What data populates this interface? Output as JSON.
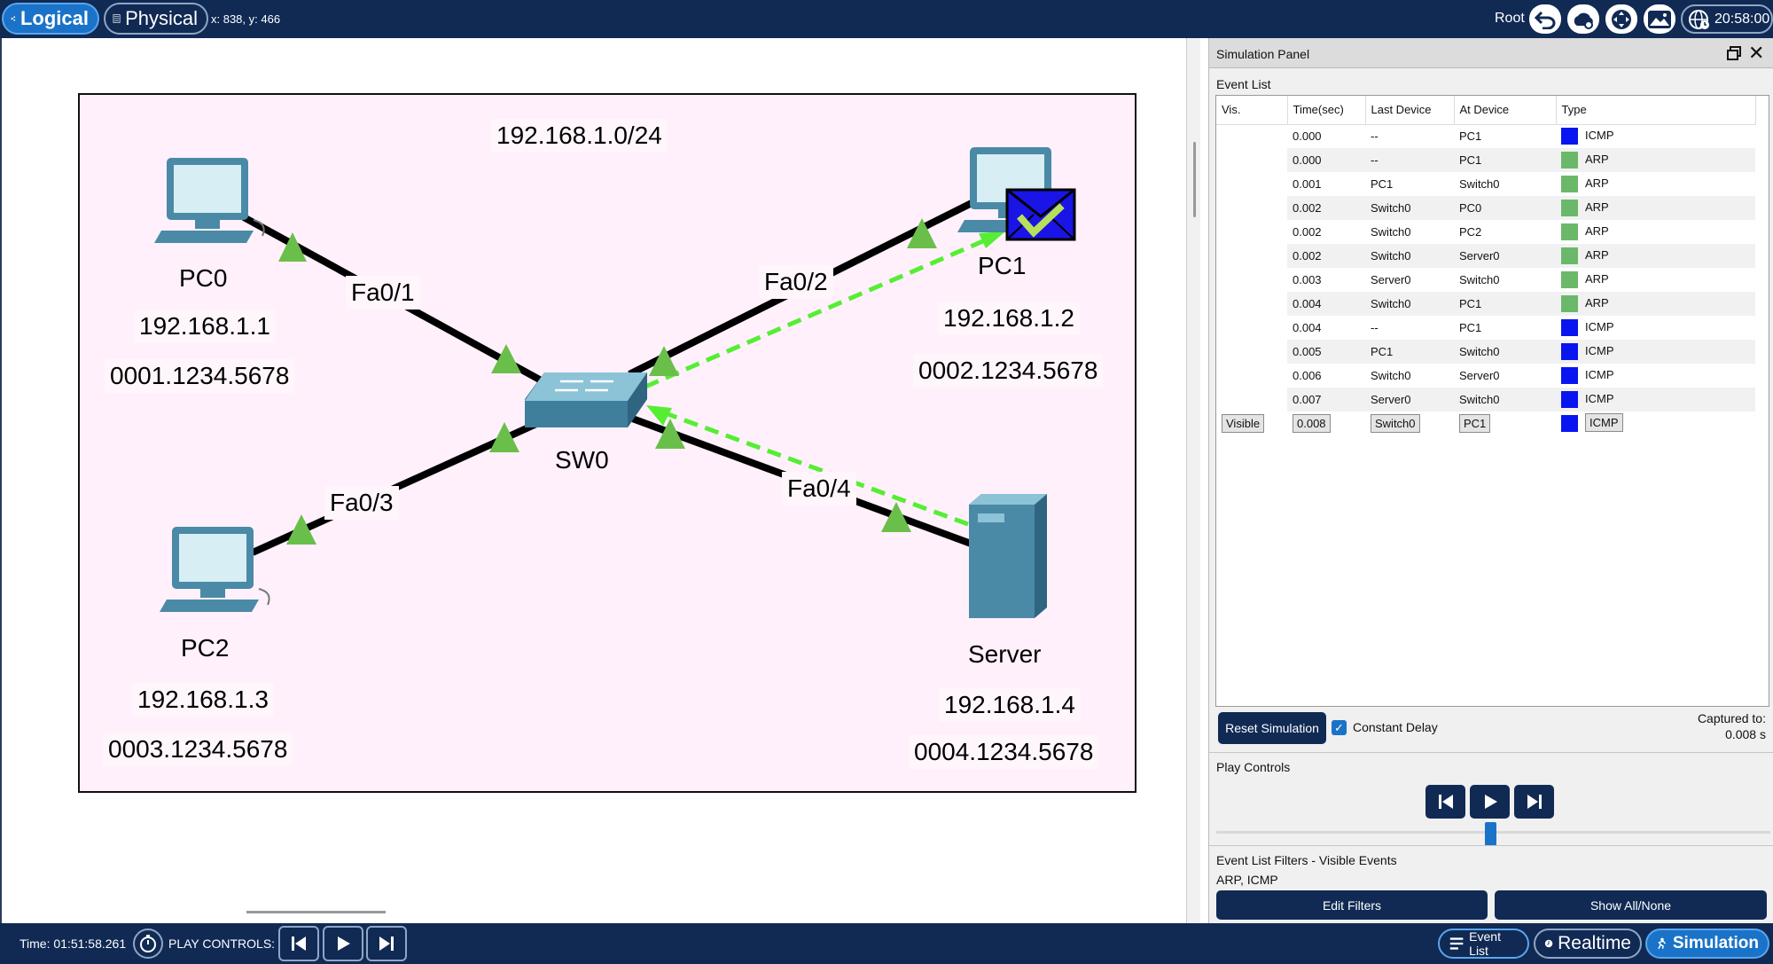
{
  "toolbar": {
    "logical_label": "Logical",
    "physical_label": "Physical",
    "coords": "x: 838, y: 466",
    "user": "Root",
    "clock": "20:58:00"
  },
  "topology": {
    "network": "192.168.1.0/24",
    "switch": {
      "name": "SW0"
    },
    "devices": [
      {
        "name": "PC0",
        "ip": "192.168.1.1",
        "mac": "0001.1234.5678",
        "port": "Fa0/1"
      },
      {
        "name": "PC1",
        "ip": "192.168.1.2",
        "mac": "0002.1234.5678",
        "port": "Fa0/2"
      },
      {
        "name": "PC2",
        "ip": "192.168.1.3",
        "mac": "0003.1234.5678",
        "port": "Fa0/3"
      },
      {
        "name": "Server",
        "ip": "192.168.1.4",
        "mac": "0004.1234.5678",
        "port": "Fa0/4"
      }
    ]
  },
  "sim_panel": {
    "title": "Simulation Panel",
    "event_list_label": "Event List",
    "columns": [
      "Vis.",
      "Time(sec)",
      "Last Device",
      "At Device",
      "Type"
    ],
    "events": [
      {
        "vis": "",
        "time": "0.000",
        "last": "--",
        "at": "PC1",
        "type": "ICMP"
      },
      {
        "vis": "",
        "time": "0.000",
        "last": "--",
        "at": "PC1",
        "type": "ARP"
      },
      {
        "vis": "",
        "time": "0.001",
        "last": "PC1",
        "at": "Switch0",
        "type": "ARP"
      },
      {
        "vis": "",
        "time": "0.002",
        "last": "Switch0",
        "at": "PC0",
        "type": "ARP"
      },
      {
        "vis": "",
        "time": "0.002",
        "last": "Switch0",
        "at": "PC2",
        "type": "ARP"
      },
      {
        "vis": "",
        "time": "0.002",
        "last": "Switch0",
        "at": "Server0",
        "type": "ARP"
      },
      {
        "vis": "",
        "time": "0.003",
        "last": "Server0",
        "at": "Switch0",
        "type": "ARP"
      },
      {
        "vis": "",
        "time": "0.004",
        "last": "Switch0",
        "at": "PC1",
        "type": "ARP"
      },
      {
        "vis": "",
        "time": "0.004",
        "last": "--",
        "at": "PC1",
        "type": "ICMP"
      },
      {
        "vis": "",
        "time": "0.005",
        "last": "PC1",
        "at": "Switch0",
        "type": "ICMP"
      },
      {
        "vis": "",
        "time": "0.006",
        "last": "Switch0",
        "at": "Server0",
        "type": "ICMP"
      },
      {
        "vis": "",
        "time": "0.007",
        "last": "Server0",
        "at": "Switch0",
        "type": "ICMP"
      },
      {
        "vis": "Visible",
        "time": "0.008",
        "last": "Switch0",
        "at": "PC1",
        "type": "ICMP",
        "selected": true
      }
    ],
    "type_colors": {
      "ICMP": "#0a14f0",
      "ARP": "#6bb86b"
    },
    "reset_label": "Reset Simulation",
    "constant_delay_label": "Constant Delay",
    "constant_delay_checked": true,
    "captured_label": "Captured to:",
    "captured_value": "0.008 s",
    "play_controls_label": "Play Controls",
    "filters_label": "Event List Filters - Visible Events",
    "filters_value": "ARP, ICMP",
    "edit_filters_label": "Edit Filters",
    "show_all_label": "Show All/None"
  },
  "bottombar": {
    "time": "Time: 01:51:58.261",
    "play_controls": "PLAY CONTROLS:",
    "event_list_tab": "Event List",
    "realtime_tab": "Realtime",
    "simulation_tab": "Simulation"
  },
  "colors": {
    "toolbar_bg": "#102a54",
    "accent": "#1a73c8",
    "area_bg": "#fff0fb",
    "link": "#000000",
    "port_up": "#6abf4b",
    "pdu_path": "#55ee33"
  }
}
